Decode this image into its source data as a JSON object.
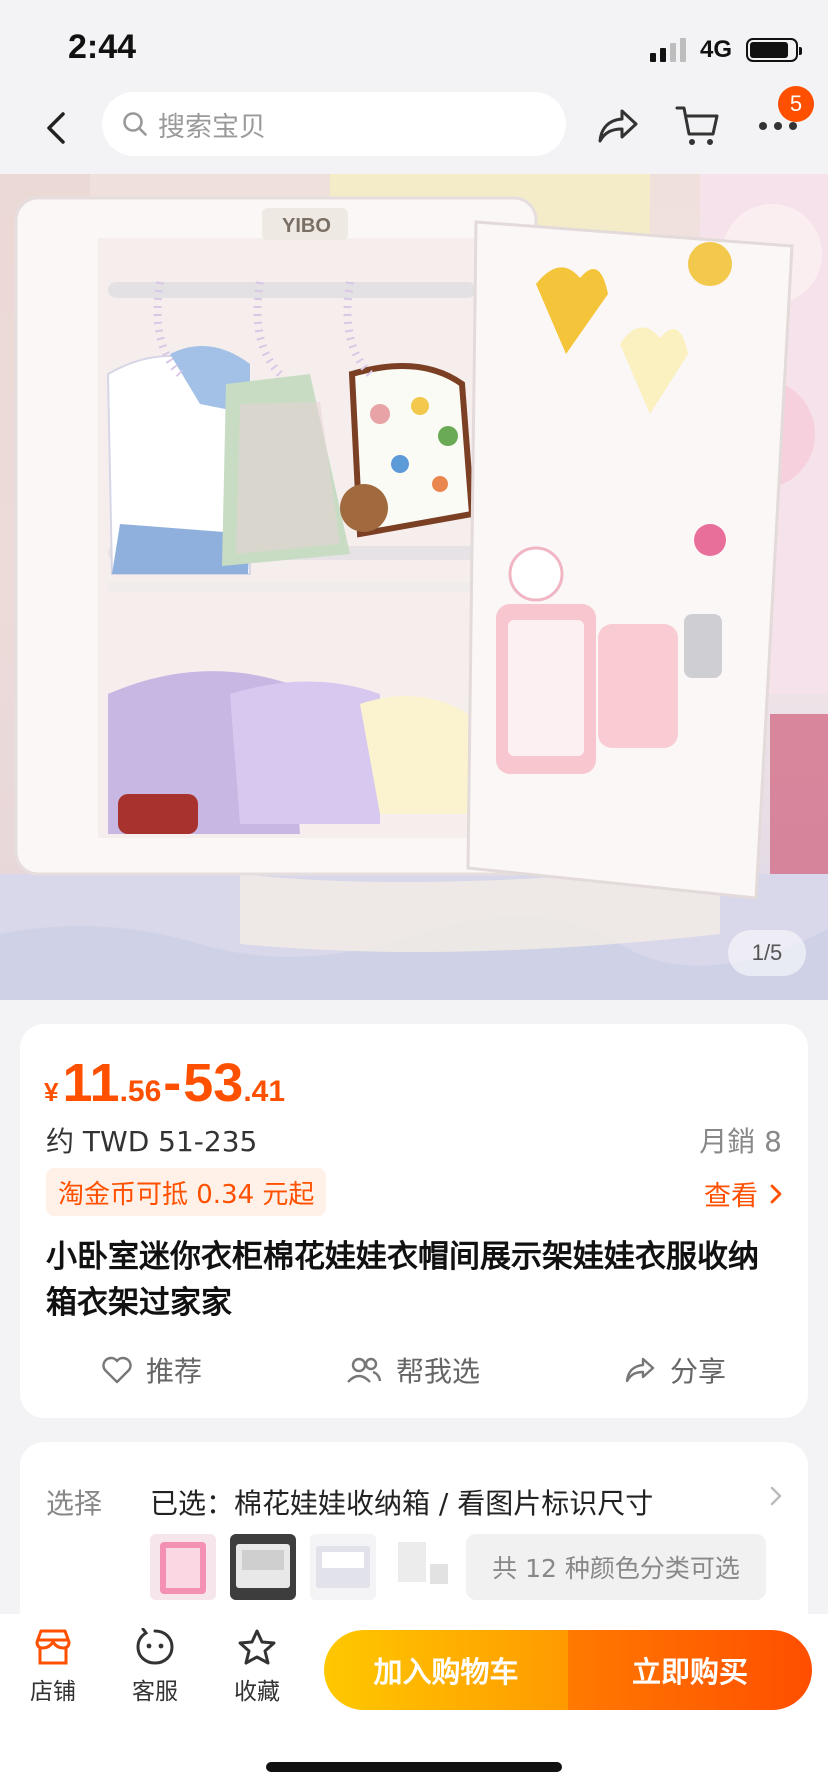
{
  "status_bar": {
    "time": "2:44",
    "network": "4G"
  },
  "nav": {
    "search_placeholder": "搜索宝贝",
    "cart_badge": "5"
  },
  "gallery": {
    "counter": "1/5",
    "brand_text": "YIBO"
  },
  "price": {
    "currency": "¥",
    "low_int": "11",
    "low_dec": ".56",
    "dash": "-",
    "high_int": "53",
    "high_dec": ".41"
  },
  "twd_price": "约 TWD 51-235",
  "monthly_sales": "月銷 8",
  "coin_offer": "淘金币可抵 0.34 元起",
  "view_link": "查看",
  "product_title": "小卧室迷你衣柜棉花娃娃衣帽间展示架娃娃衣服收纳箱衣架过家家",
  "actions": {
    "recommend": "推荐",
    "help_choose": "帮我选",
    "share": "分享"
  },
  "spec": {
    "label": "选择",
    "selected": "已选：棉花娃娃收纳箱 / 看图片标识尺寸",
    "color_count": "共 12 种颜色分类可选"
  },
  "bottom_bar": {
    "store": "店铺",
    "service": "客服",
    "favorite": "收藏",
    "add_cart": "加入购物车",
    "buy_now": "立即购买"
  },
  "colors": {
    "accent": "#ff5000",
    "cart_gradient": [
      "#ffc800",
      "#ff9a00"
    ],
    "buy_gradient": [
      "#ff7a00",
      "#ff4e00"
    ]
  }
}
